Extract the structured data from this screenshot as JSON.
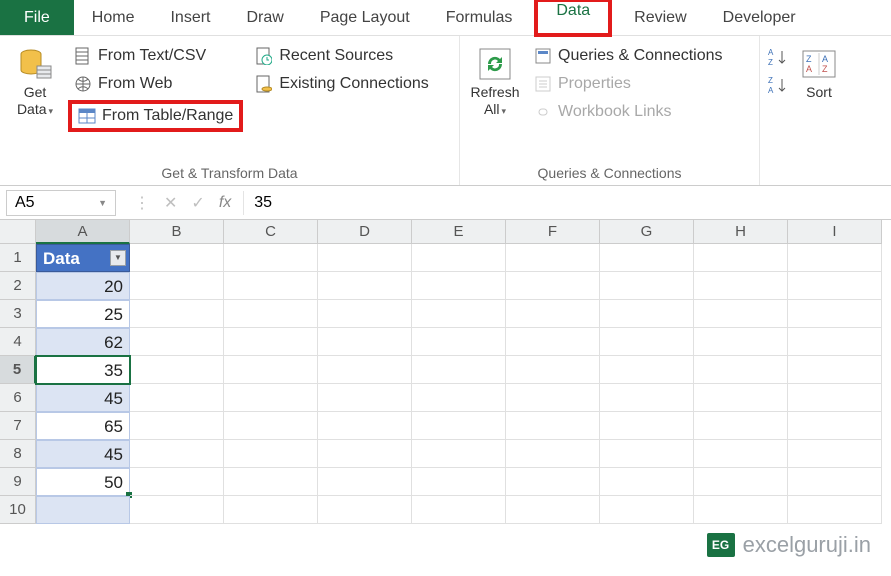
{
  "tabs": {
    "file": "File",
    "home": "Home",
    "insert": "Insert",
    "draw": "Draw",
    "page_layout": "Page Layout",
    "formulas": "Formulas",
    "data": "Data",
    "review": "Review",
    "developer": "Developer"
  },
  "ribbon": {
    "get_data": "Get\nData",
    "from_text_csv": "From Text/CSV",
    "from_web": "From Web",
    "from_table_range": "From Table/Range",
    "recent_sources": "Recent Sources",
    "existing_connections": "Existing Connections",
    "group1_label": "Get & Transform Data",
    "refresh_all": "Refresh\nAll",
    "queries_connections": "Queries & Connections",
    "properties": "Properties",
    "workbook_links": "Workbook Links",
    "group2_label": "Queries & Connections",
    "sort": "Sort"
  },
  "formula_bar": {
    "name_box": "A5",
    "fx": "fx",
    "value": "35"
  },
  "columns": [
    "A",
    "B",
    "C",
    "D",
    "E",
    "F",
    "G",
    "H",
    "I"
  ],
  "rows": [
    {
      "n": "1",
      "header": "Data"
    },
    {
      "n": "2",
      "val": "20"
    },
    {
      "n": "3",
      "val": "25"
    },
    {
      "n": "4",
      "val": "62"
    },
    {
      "n": "5",
      "val": "35"
    },
    {
      "n": "6",
      "val": "45"
    },
    {
      "n": "7",
      "val": "65"
    },
    {
      "n": "8",
      "val": "45"
    },
    {
      "n": "9",
      "val": "50"
    },
    {
      "n": "10",
      "val": ""
    }
  ],
  "watermark": {
    "badge": "EG",
    "text": "excelguruji.in"
  }
}
